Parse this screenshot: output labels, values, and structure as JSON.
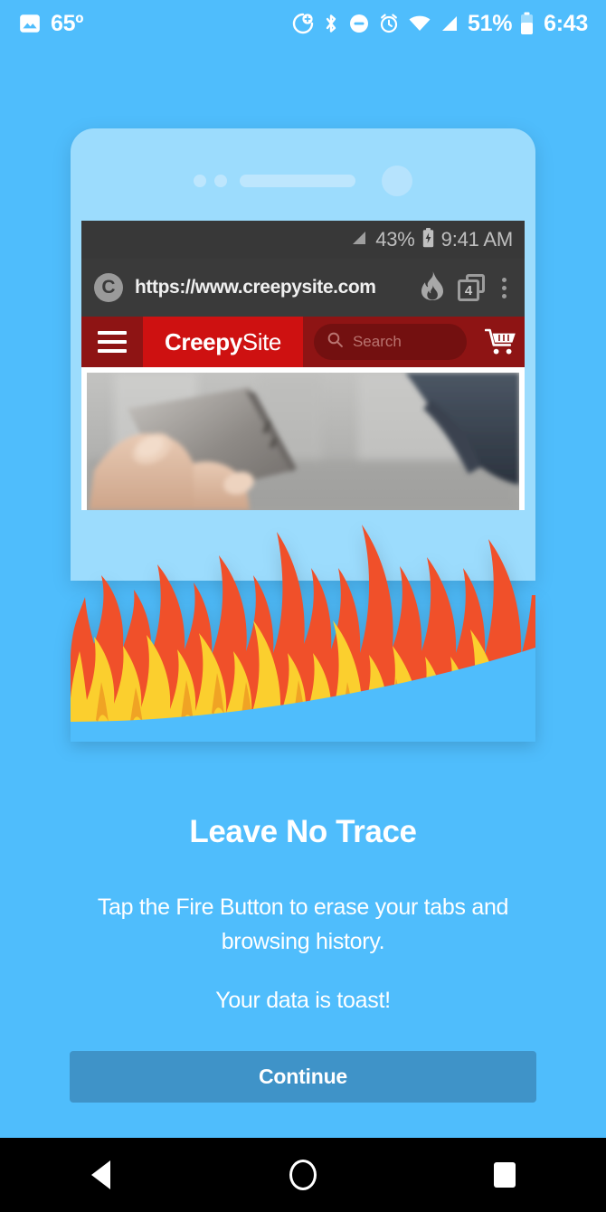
{
  "system_status_bar": {
    "weather_temp": "65º",
    "weather_icon": "image-icon",
    "icons": [
      "location-add-icon",
      "bluetooth-icon",
      "do-not-disturb-icon",
      "alarm-icon",
      "wifi-icon",
      "cellular-signal-icon"
    ],
    "battery_percent": "51%",
    "clock": "6:43"
  },
  "phone_mockup": {
    "browser_status_bar": {
      "battery_percent": "43%",
      "clock": "9:41 AM",
      "signal_icon": "cellular-signal-icon",
      "battery_icon": "battery-charging-icon"
    },
    "browser_toolbar": {
      "favicon_letter": "C",
      "url": "https://www.creepysite.com",
      "fire_icon": "fire-button-icon",
      "tab_count": "4",
      "menu_icon": "kebab-menu-icon"
    },
    "site_header": {
      "menu_icon": "hamburger-icon",
      "brand_bold": "Creepy",
      "brand_light": "Site",
      "search_placeholder": "Search",
      "search_icon": "search-icon",
      "cart_icon": "shopping-cart-icon"
    }
  },
  "onboarding": {
    "headline": "Leave No Trace",
    "body": "Tap the Fire Button to erase your tabs and browsing history.",
    "body2": "Your data is toast!",
    "continue_label": "Continue"
  },
  "nav_bar": {
    "back_label": "Back",
    "home_label": "Home",
    "recents_label": "Recents"
  },
  "colors": {
    "background_blue": "#4FBDFC",
    "phone_body_blue": "#9CDCFD",
    "button_blue": "#3F93C8",
    "flame_yellow": "#FBCF2E",
    "flame_orange": "#F0A024",
    "flame_red": "#F0502A",
    "site_red": "#CE1111",
    "site_dark_red": "#8E1414",
    "browser_chrome": "#383838"
  }
}
